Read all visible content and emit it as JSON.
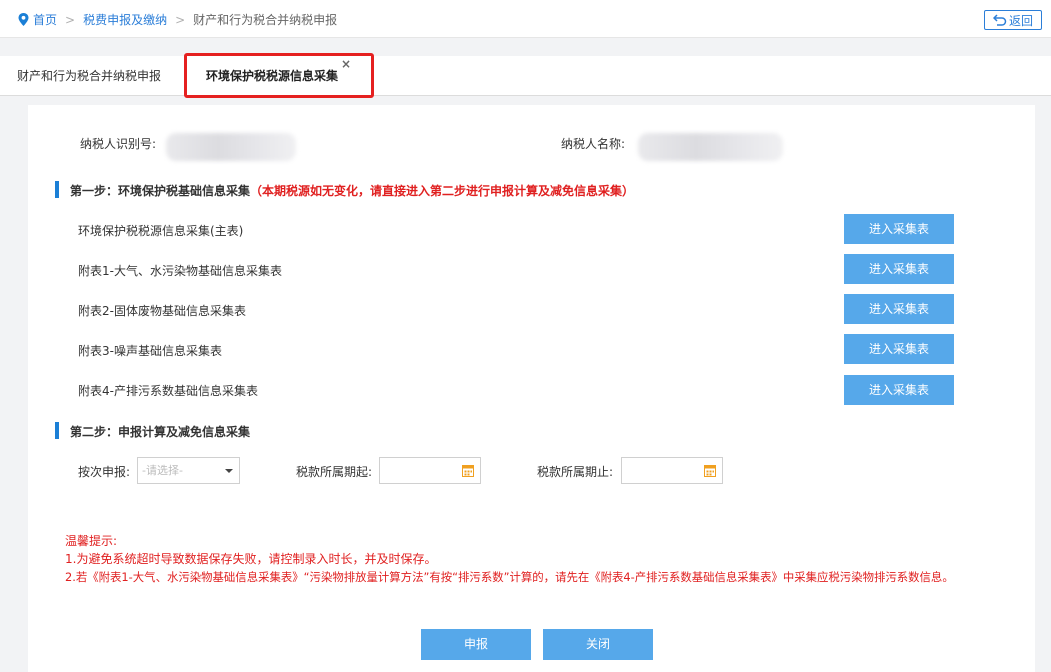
{
  "breadcrumb": {
    "home": "首页",
    "level2": "税费申报及缴纳",
    "current": "财产和行为税合并纳税申报",
    "back": "返回"
  },
  "tabs": [
    {
      "label": "财产和行为税合并纳税申报"
    },
    {
      "label": "环境保护税税源信息采集",
      "close": "×"
    }
  ],
  "taxpayer": {
    "id_label": "纳税人识别号:",
    "name_label": "纳税人名称:"
  },
  "step1": {
    "title": "第一步：环境保护税基础信息采集",
    "note": "（本期税源如无变化，请直接进入第二步进行申报计算及减免信息采集）",
    "rows": [
      {
        "label": "环境保护税税源信息采集(主表)",
        "button": "进入采集表"
      },
      {
        "label": "附表1-大气、水污染物基础信息采集表",
        "button": "进入采集表"
      },
      {
        "label": "附表2-固体废物基础信息采集表",
        "button": "进入采集表"
      },
      {
        "label": "附表3-噪声基础信息采集表",
        "button": "进入采集表"
      },
      {
        "label": "附表4-产排污系数基础信息采集表",
        "button": "进入采集表"
      }
    ]
  },
  "step2": {
    "title": "第二步：申报计算及减免信息采集",
    "by_label": "按次申报:",
    "by_placeholder": "-请选择-",
    "start_label": "税款所属期起:",
    "end_label": "税款所属期止:"
  },
  "tips": {
    "heading": "温馨提示:",
    "line1": "1.为避免系统超时导致数据保存失败，请控制录入时长，并及时保存。",
    "line2": "2.若《附表1-大气、水污染物基础信息采集表》“污染物排放量计算方法”有按“排污系数”计算的，请先在《附表4-产排污系数基础信息采集表》中采集应税污染物排污系数信息。"
  },
  "actions": {
    "submit": "申报",
    "close": "关闭"
  },
  "colors": {
    "accent": "#1b7fd6",
    "button": "#56a8ea",
    "warning": "#e02020"
  }
}
